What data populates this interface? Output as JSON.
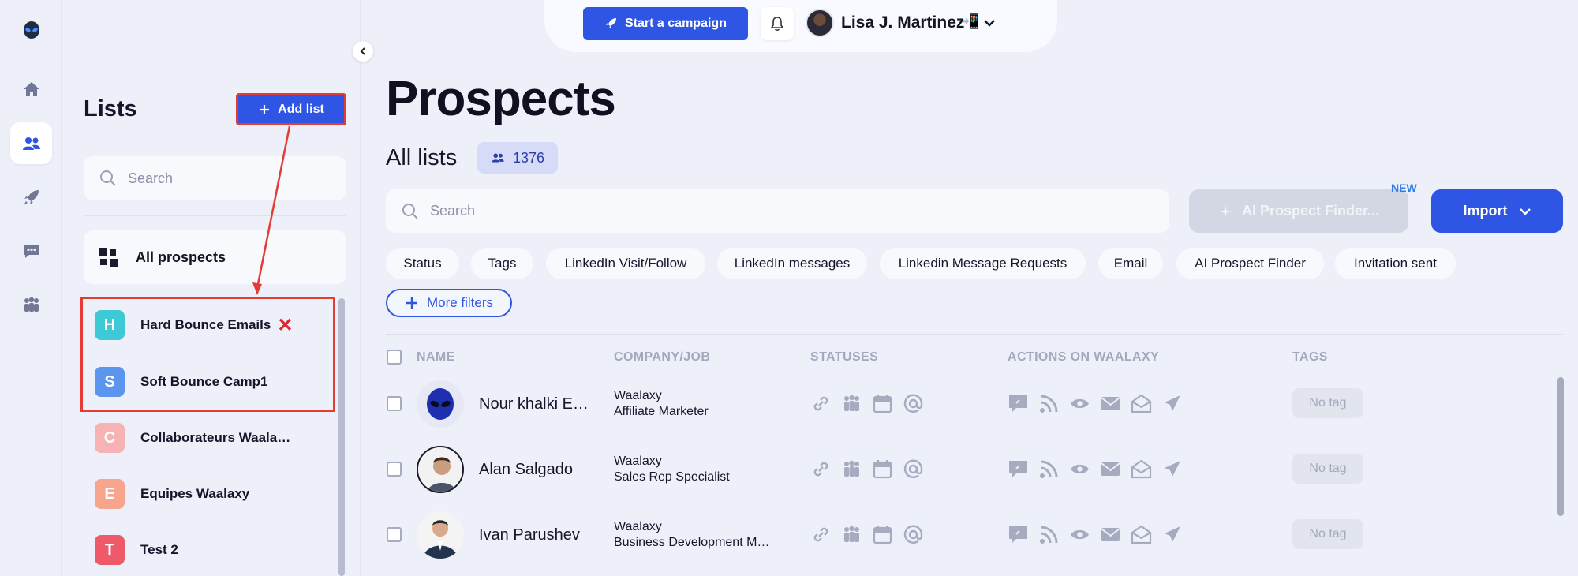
{
  "colors": {
    "accent": "#2f55e4",
    "highlight": "#e43b33",
    "background": "#eef0f9"
  },
  "rail": {
    "items": [
      {
        "icon": "alien-logo-icon",
        "active": false
      },
      {
        "icon": "home-icon",
        "active": false
      },
      {
        "icon": "users-icon",
        "active": true
      },
      {
        "icon": "rocket-icon",
        "active": false
      },
      {
        "icon": "chat-icon",
        "active": false
      },
      {
        "icon": "team-icon",
        "active": false
      }
    ]
  },
  "lists_panel": {
    "title": "Lists",
    "add_list_label": "Add list",
    "search_placeholder": "Search",
    "all_prospects_label": "All prospects",
    "items": [
      {
        "letter": "H",
        "label": "Hard Bounce Emails",
        "color": "#3ec9d6",
        "marked": true
      },
      {
        "letter": "S",
        "label": "Soft Bounce Camp1",
        "color": "#5b95ee",
        "marked": false
      },
      {
        "letter": "C",
        "label": "Collaborateurs Waala…",
        "color": "#f7b2b4",
        "marked": false
      },
      {
        "letter": "E",
        "label": "Equipes Waalaxy",
        "color": "#f8a58e",
        "marked": false
      },
      {
        "letter": "T",
        "label": "Test 2",
        "color": "#ef5a6a",
        "marked": false
      }
    ]
  },
  "topbar": {
    "start_campaign_label": "Start a campaign",
    "user_name": "Lisa J. Martinez",
    "user_emoji": "📲"
  },
  "main": {
    "title": "Prospects",
    "subtitle": "All lists",
    "count": "1376",
    "search_placeholder": "Search",
    "ai_finder_label": "AI Prospect Finder...",
    "new_badge": "NEW",
    "import_label": "Import",
    "filters": [
      "Status",
      "Tags",
      "LinkedIn Visit/Follow",
      "LinkedIn messages",
      "Linkedin Message Requests",
      "Email",
      "AI Prospect Finder",
      "Invitation sent"
    ],
    "more_filters_label": "More filters",
    "columns": [
      "NAME",
      "COMPANY/JOB",
      "STATUSES",
      "ACTIONS ON WAALAXY",
      "TAGS"
    ],
    "rows": [
      {
        "name": "Nour khalki E…",
        "company": "Waalaxy",
        "job": "Affiliate Marketer",
        "tag": "No tag"
      },
      {
        "name": "Alan Salgado",
        "company": "Waalaxy",
        "job": "Sales Rep Specialist",
        "tag": "No tag"
      },
      {
        "name": "Ivan Parushev",
        "company": "Waalaxy",
        "job": "Business Development M…",
        "tag": "No tag"
      }
    ]
  }
}
